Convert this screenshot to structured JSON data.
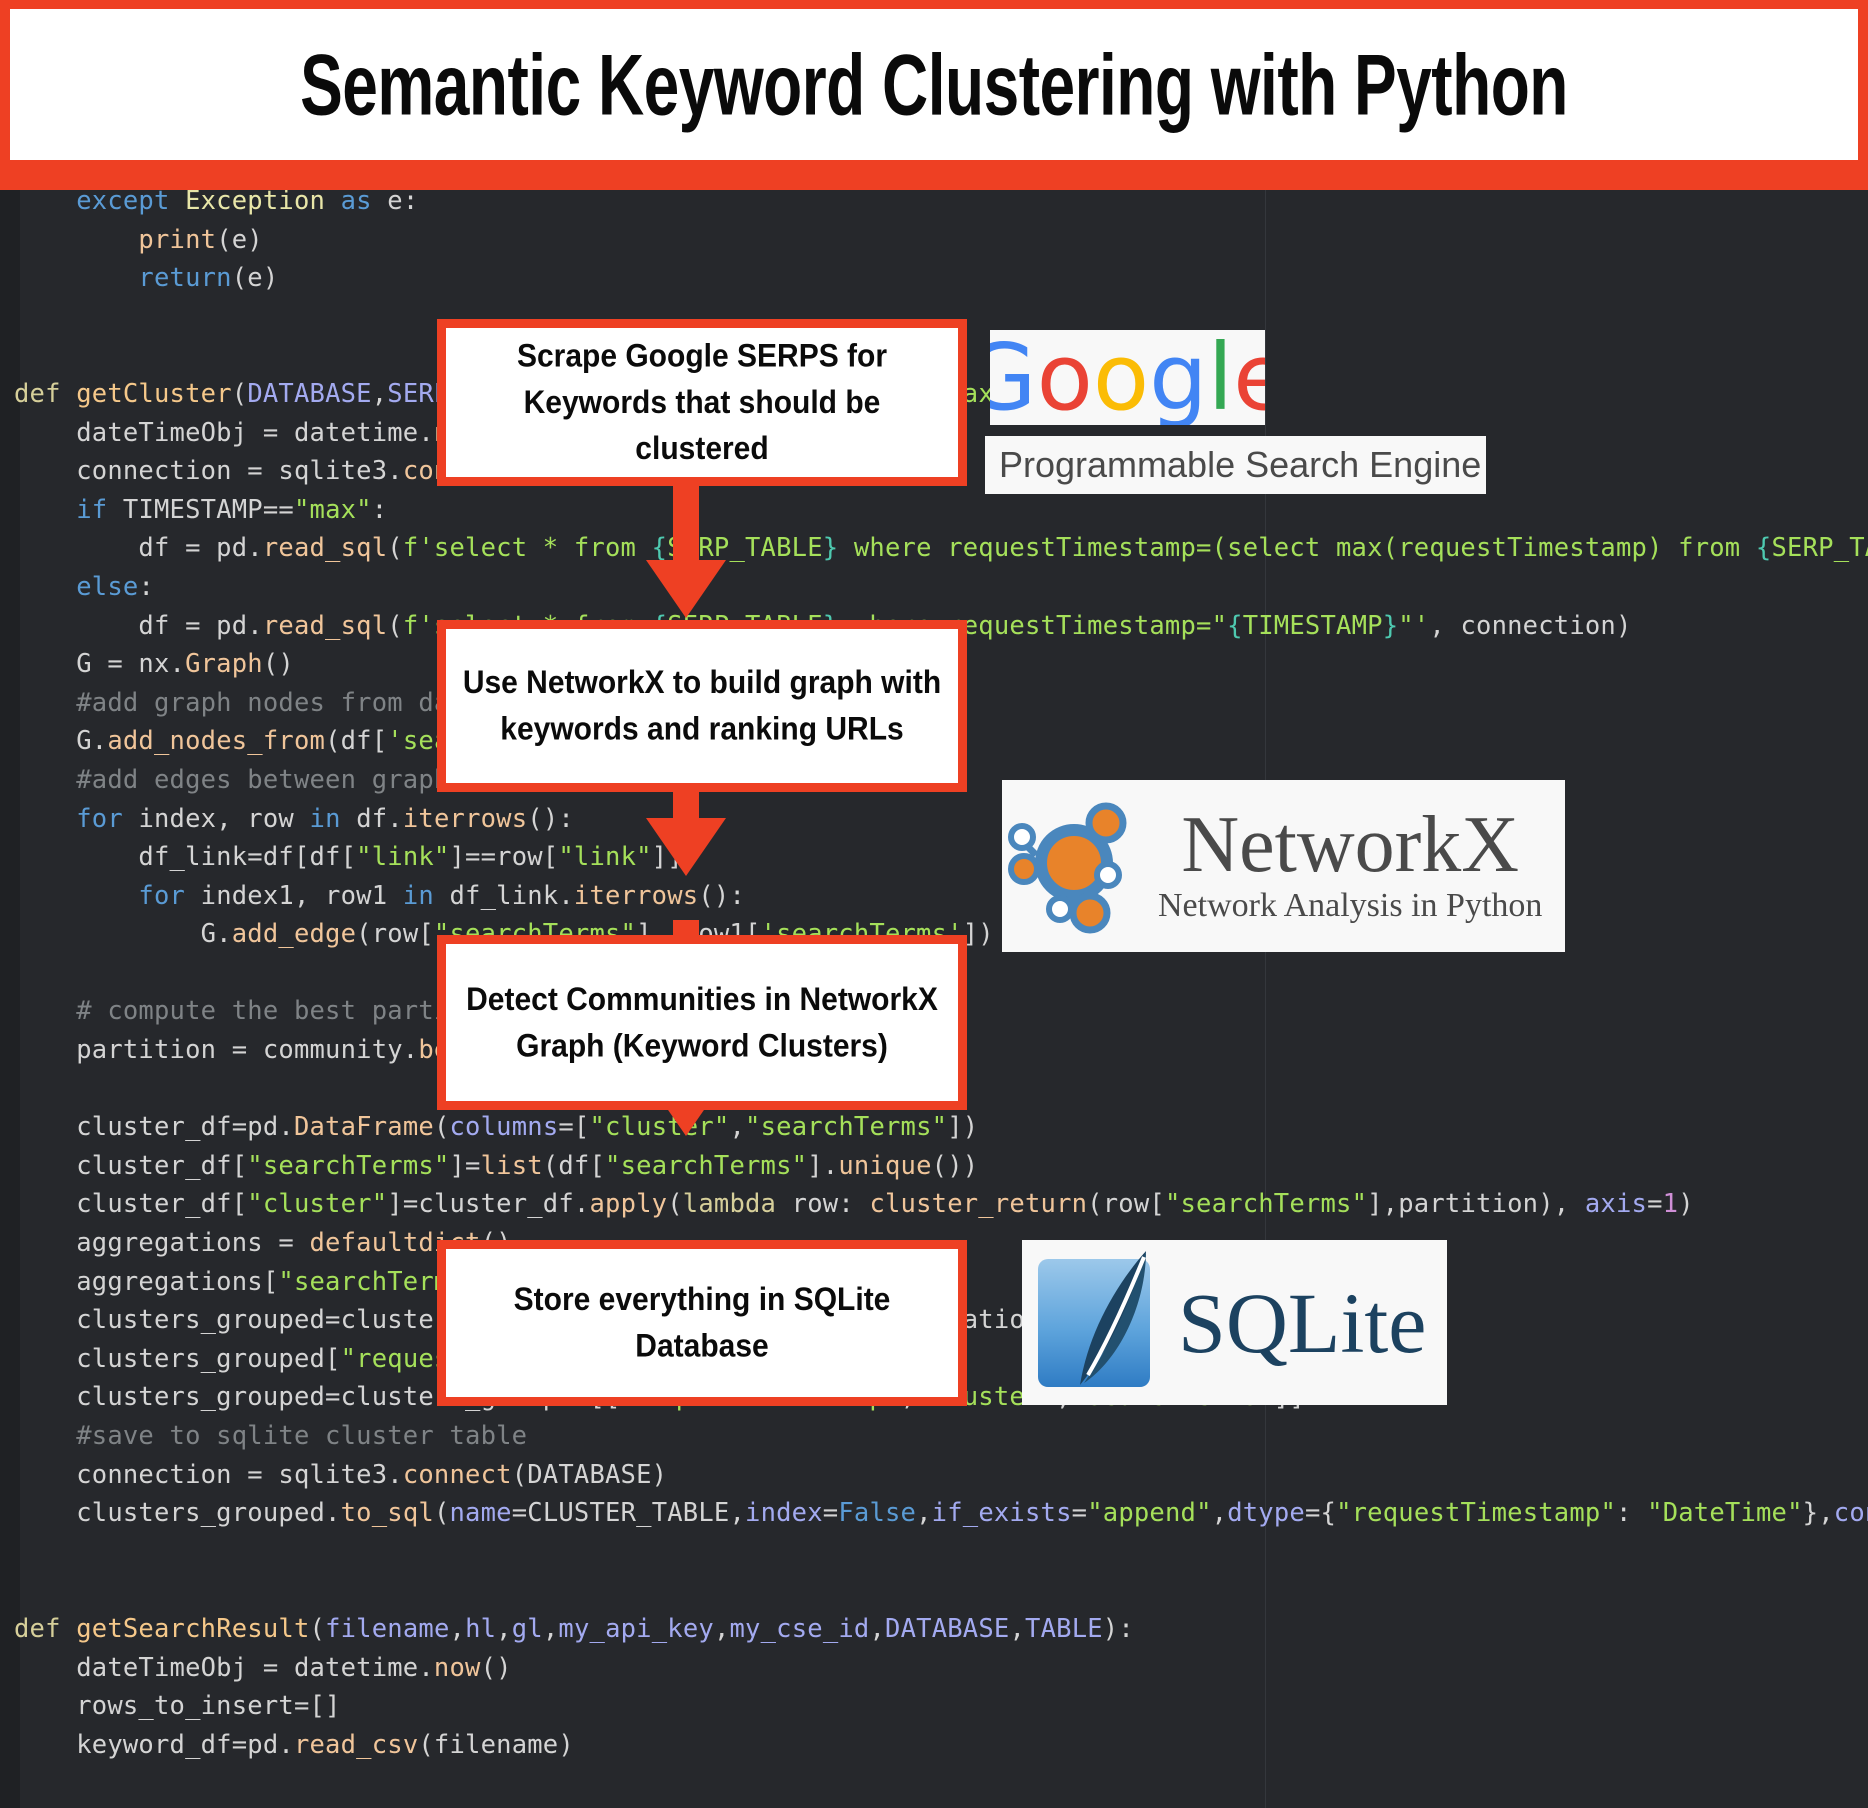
{
  "title": {
    "text": "Semantic Keyword Clustering with Python",
    "banner_color": "#EE4023",
    "plate_color": "#FFFFFF"
  },
  "code": {
    "language": "python",
    "background": "#26282c",
    "lines_plain": "    except Exception as e:\n        print(e)\n        return(e)\n\n\ndef getCluster(DATABASE,SERP_TABLE,CLUSTER_TABLE,TIMESTAMP=\"max\"):\n    dateTimeObj = datetime.now()\n    connection = sqlite3.connect(DATABASE)\n    if TIMESTAMP==\"max\":\n        df = pd.read_sql(f'select * from {SERP_TABLE} where requestTimestamp=(select max(requestTimestamp) from {SERP_TABLE})', connection)\n    else:\n        df = pd.read_sql(f'select * from {SERP_TABLE} where requestTimestamp=\"{TIMESTAMP}\"', connection)\n    G = nx.Graph()\n    #add graph nodes from dataframe column\n    G.add_nodes_from(df['searchTerms'])\n    #add edges between graph nodes:\n    for index, row in df.iterrows():\n        df_link=df[df[\"link\"]==row[\"link\"]]\n        for index1, row1 in df_link.iterrows():\n            G.add_edge(row[\"searchTerms\"], row1['searchTerms'])\n\n    # compute the best partition for community (clusters)\n    partition = community.best_partition(G)\n\n    cluster_df=pd.DataFrame(columns=[\"cluster\",\"searchTerms\"])\n    cluster_df[\"searchTerms\"]=list(df[\"searchTerms\"].unique())\n    cluster_df[\"cluster\"]=cluster_df.apply(lambda row: cluster_return(row[\"searchTerms\"],partition), axis=1)\n    aggregations = defaultdict()\n    aggregations[\"searchTerms\"]=' | '.join\n    clusters_grouped=cluster_df.groupby(\"cluster\").agg(aggregations).reset_index()\n    clusters_grouped[\"requestTimestamp\"]=dateTimeObj\n    clusters_grouped=clusters_grouped[[\"requestTimestamp\",\"cluster\",\"searchTerms\"]]\n    #save to sqlite cluster table\n    connection = sqlite3.connect(DATABASE)\n    clusters_grouped.to_sql(name=CLUSTER_TABLE,index=False,if_exists=\"append\",dtype={\"requestTimestamp\": \"DateTime\"},con=connection)\n\n\ndef getSearchResult(filename,hl,gl,my_api_key,my_cse_id,DATABASE,TABLE):\n    dateTimeObj = datetime.now()\n    rows_to_insert=[]\n    keyword_df=pd.read_csv(filename)"
  },
  "flow": {
    "accent_color": "#EE4023",
    "steps": [
      {
        "id": "scrape",
        "label": "Scrape Google SERPS for Keywords that should be clustered"
      },
      {
        "id": "build-graph",
        "label": "Use NetworkX to build graph with keywords and ranking URLs"
      },
      {
        "id": "detect-communities",
        "label": "Detect Communities in NetworkX Graph (Keyword Clusters)"
      },
      {
        "id": "store-sqlite",
        "label": "Store everything in SQLite Database"
      }
    ]
  },
  "logos": {
    "google": {
      "letters": [
        {
          "char": "G",
          "color": "#4285F4"
        },
        {
          "char": "o",
          "color": "#EA4335"
        },
        {
          "char": "o",
          "color": "#FBBC05"
        },
        {
          "char": "g",
          "color": "#4285F4"
        },
        {
          "char": "l",
          "color": "#34A853"
        },
        {
          "char": "e",
          "color": "#EA4335"
        }
      ],
      "caption": "Programmable Search Engine"
    },
    "networkx": {
      "title": "NetworkX",
      "subtitle": "Network Analysis in Python",
      "node_color": "#E8832A",
      "ring_color": "#4A87BD"
    },
    "sqlite": {
      "wordmark": "SQLite",
      "tile_color": "#3E8FD0",
      "feather_color": "#1C4260"
    }
  }
}
